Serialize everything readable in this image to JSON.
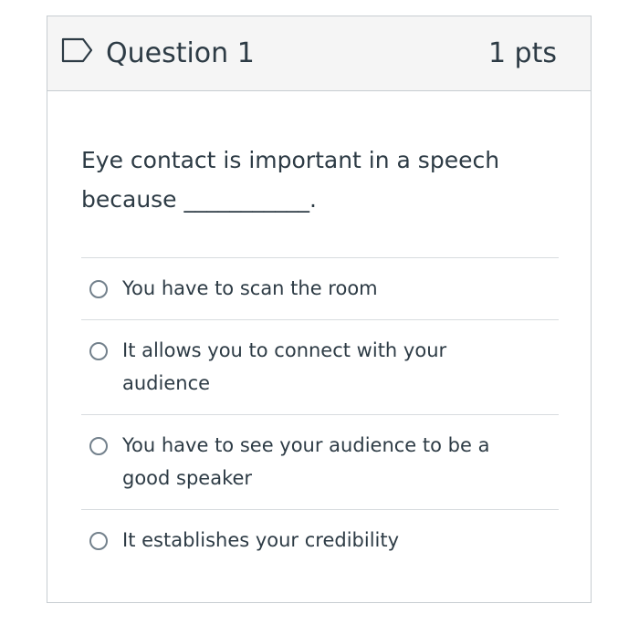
{
  "question": {
    "title": "Question 1",
    "points": "1 pts",
    "text": "Eye contact is important in a speech because ___________.",
    "flag_icon": "flag-outline-icon"
  },
  "answers": [
    {
      "label": "You have to scan the room",
      "selected": false
    },
    {
      "label": "It allows you to connect with your audience",
      "selected": false
    },
    {
      "label": "You have to see your audience to be a good speaker",
      "selected": false
    },
    {
      "label": "It establishes your credibility",
      "selected": false
    }
  ],
  "colors": {
    "header_bg": "#f5f5f5",
    "border": "#c7cdd1",
    "text": "#2d3b45",
    "radio_border": "#73818c"
  }
}
